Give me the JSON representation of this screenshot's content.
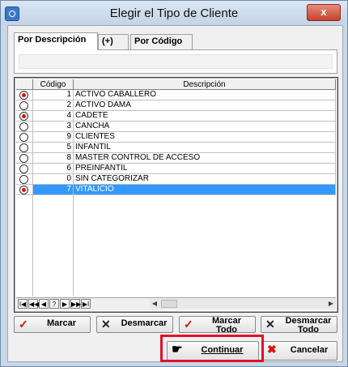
{
  "window": {
    "title": "Elegir el Tipo de Cliente",
    "close_label": "x"
  },
  "tabs": [
    {
      "label": "Por Descripción",
      "active": true
    },
    {
      "label": "(+)",
      "active": false
    },
    {
      "label": "Por Código",
      "active": false
    }
  ],
  "grid": {
    "columns": [
      "Código",
      "Descripción"
    ],
    "rows": [
      {
        "code": "1",
        "desc": "ACTIVO CABALLERO",
        "checked": true,
        "selected": false
      },
      {
        "code": "2",
        "desc": "ACTIVO DAMA",
        "checked": false,
        "selected": false
      },
      {
        "code": "4",
        "desc": "CADETE",
        "checked": true,
        "selected": false
      },
      {
        "code": "3",
        "desc": "CANCHA",
        "checked": false,
        "selected": false
      },
      {
        "code": "9",
        "desc": "CLIENTES",
        "checked": false,
        "selected": false
      },
      {
        "code": "5",
        "desc": "INFANTIL",
        "checked": false,
        "selected": false
      },
      {
        "code": "8",
        "desc": "MASTER CONTROL DE ACCESO",
        "checked": false,
        "selected": false
      },
      {
        "code": "6",
        "desc": "PREINFANTIL",
        "checked": false,
        "selected": false
      },
      {
        "code": "0",
        "desc": "SIN CATEGORIZAR",
        "checked": false,
        "selected": false
      },
      {
        "code": "7",
        "desc": "VITALICIO",
        "checked": true,
        "selected": true
      }
    ]
  },
  "navigator": {
    "buttons": [
      "I◀",
      "◀◀",
      "◀",
      "?",
      "▶",
      "▶▶",
      "▶I"
    ],
    "scroll_left": "◀",
    "scroll_right": "▶"
  },
  "buttons": {
    "marcar": "Marcar",
    "desmarcar": "Desmarcar",
    "marcar_todo": "Marcar Todo",
    "desmarcar_todo": "Desmarcar Todo",
    "continuar": "Continuar",
    "cancelar": "Cancelar"
  },
  "colors": {
    "selection": "#3399ff",
    "radio_on": "#e01010",
    "highlight_box": "#e0102a"
  }
}
